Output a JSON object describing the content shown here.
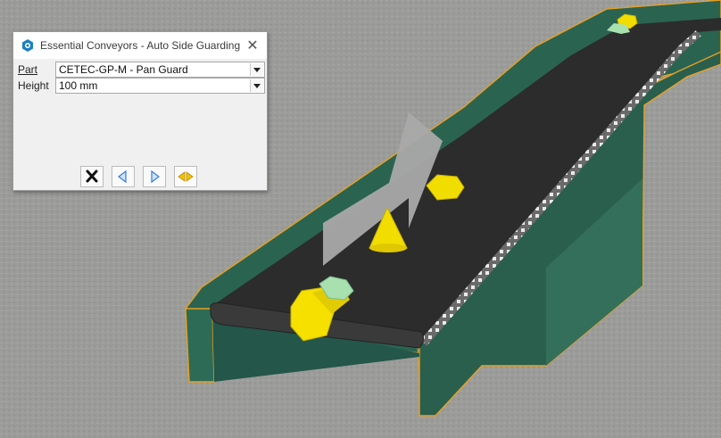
{
  "dialog": {
    "title": "Essential Conveyors - Auto Side Guarding",
    "close_glyph": "✕",
    "fields": [
      {
        "label": "Part",
        "value": "CETEC-GP-M - Pan Guard"
      },
      {
        "label": "Height",
        "value": "100 mm"
      }
    ],
    "buttons": [
      {
        "name": "cancel-button",
        "icon": "x-icon"
      },
      {
        "name": "previous-button",
        "icon": "left-arrow-icon"
      },
      {
        "name": "next-button",
        "icon": "right-arrow-icon"
      },
      {
        "name": "flip-direction-button",
        "icon": "double-arrow-icon"
      }
    ]
  },
  "colors": {
    "frame_green": "#2f6a55",
    "belt_dark": "#2c2c2c",
    "highlight_orange": "#e8a020",
    "handle_yellow": "#f2dd00",
    "direction_arrow_gray": "#a9a9a9"
  }
}
